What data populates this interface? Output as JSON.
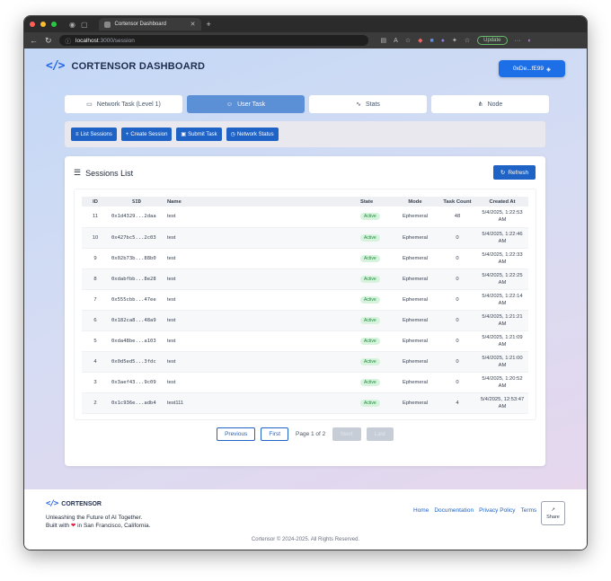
{
  "browser": {
    "tab_title": "Cortensor Dashboard",
    "url_host": "localhost",
    "url_path": ":3000/session",
    "update_label": "Update"
  },
  "header": {
    "logo_text": "CORTENSOR DASHBOARD",
    "wallet_label": "0xDe...fE99"
  },
  "tabs": [
    {
      "label": "Network Task (Level 1)",
      "icon": "monitor-icon"
    },
    {
      "label": "User Task",
      "icon": "user-icon",
      "active": true
    },
    {
      "label": "Stats",
      "icon": "activity-icon"
    },
    {
      "label": "Node",
      "icon": "network-icon"
    }
  ],
  "toolbar": {
    "list_sessions": "List Sessions",
    "create_session": "Create Session",
    "submit_task": "Submit Task",
    "network_status": "Network Status"
  },
  "sessions": {
    "title": "Sessions List",
    "refresh_label": "Refresh",
    "columns": [
      "ID",
      "SID",
      "Name",
      "State",
      "Mode",
      "Task Count",
      "Created At"
    ],
    "rows": [
      {
        "id": "11",
        "sid": "0x1d4329...2daa",
        "name": "test",
        "state": "Active",
        "mode": "Ephemeral",
        "count": "48",
        "created": "5/4/2025, 1:22:53 AM"
      },
      {
        "id": "10",
        "sid": "0x427bc5...2c03",
        "name": "test",
        "state": "Active",
        "mode": "Ephemeral",
        "count": "0",
        "created": "5/4/2025, 1:22:46 AM"
      },
      {
        "id": "9",
        "sid": "0x02b73b...88b0",
        "name": "test",
        "state": "Active",
        "mode": "Ephemeral",
        "count": "0",
        "created": "5/4/2025, 1:22:33 AM"
      },
      {
        "id": "8",
        "sid": "0xdabfbb...8e28",
        "name": "test",
        "state": "Active",
        "mode": "Ephemeral",
        "count": "0",
        "created": "5/4/2025, 1:22:25 AM"
      },
      {
        "id": "7",
        "sid": "0x555cbb...47ee",
        "name": "test",
        "state": "Active",
        "mode": "Ephemeral",
        "count": "0",
        "created": "5/4/2025, 1:22:14 AM"
      },
      {
        "id": "6",
        "sid": "0x182ca8...48a9",
        "name": "test",
        "state": "Active",
        "mode": "Ephemeral",
        "count": "0",
        "created": "5/4/2025, 1:21:21 AM"
      },
      {
        "id": "5",
        "sid": "0xda48be...a103",
        "name": "test",
        "state": "Active",
        "mode": "Ephemeral",
        "count": "0",
        "created": "5/4/2025, 1:21:09 AM"
      },
      {
        "id": "4",
        "sid": "0x0d5ed5...3fdc",
        "name": "test",
        "state": "Active",
        "mode": "Ephemeral",
        "count": "0",
        "created": "5/4/2025, 1:21:00 AM"
      },
      {
        "id": "3",
        "sid": "0x3aef43...9c09",
        "name": "test",
        "state": "Active",
        "mode": "Ephemeral",
        "count": "0",
        "created": "5/4/2025, 1:20:52 AM"
      },
      {
        "id": "2",
        "sid": "0x1c936e...adb4",
        "name": "test111",
        "state": "Active",
        "mode": "Ephemeral",
        "count": "4",
        "created": "5/4/2025, 12:53:47 AM"
      }
    ]
  },
  "pagination": {
    "previous": "Previous",
    "first": "First",
    "info": "Page 1 of 2",
    "next": "Next",
    "last": "Last"
  },
  "footer": {
    "logo_text": "CORTENSOR",
    "tagline": "Unleashing the Future of AI Together.",
    "built_prefix": "Built with",
    "built_suffix": "in San Francisco, California.",
    "links": [
      "Home",
      "Documentation",
      "Privacy Policy",
      "Terms"
    ],
    "share_label": "Share",
    "copyright": "Cortensor © 2024-2025. All Rights Reserved."
  },
  "colors": {
    "primary": "#1f63c6",
    "active_tab": "#5b8fd6",
    "badge": "#1a8f3a"
  }
}
